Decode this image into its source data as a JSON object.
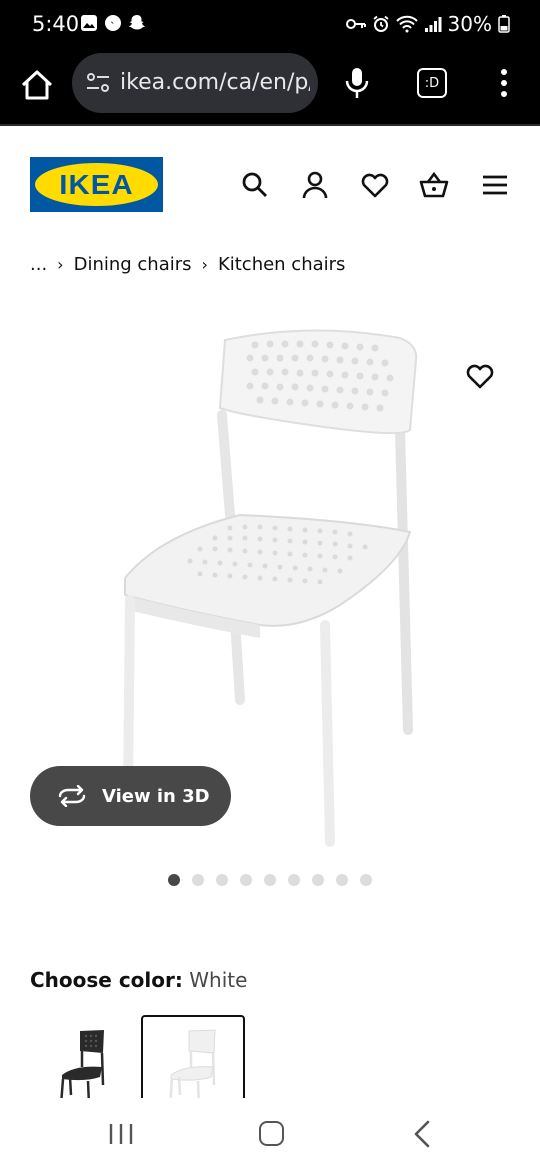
{
  "status_bar": {
    "time": "5:40",
    "battery": "30%"
  },
  "browser": {
    "url": "ikea.com/ca/en/p/",
    "tab_label": ":D"
  },
  "header": {
    "logo_text": "IKEA",
    "icons": [
      "search-icon",
      "account-icon",
      "heart-icon",
      "basket-icon",
      "menu-icon"
    ],
    "brand_blue": "#0058a3",
    "brand_yellow": "#ffdb00"
  },
  "breadcrumb": {
    "ellipsis": "...",
    "items": [
      "Dining chairs",
      "Kitchen chairs"
    ]
  },
  "product": {
    "view_3d_label": "View in 3D",
    "carousel": {
      "total": 9,
      "active_index": 0
    },
    "color_label": "Choose color:",
    "color_value": "White",
    "swatches": [
      "Black",
      "White"
    ],
    "selected_swatch": "White"
  }
}
